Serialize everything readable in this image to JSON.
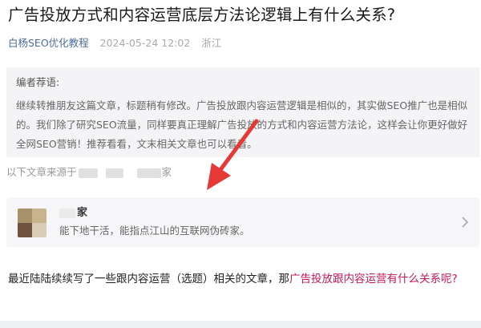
{
  "article": {
    "title": "广告投放方式和内容运营底层方法论逻辑上有什么关系?",
    "author": "白杨SEO优化教程",
    "date": "2024-05-24 12:02",
    "location": "浙江"
  },
  "editor_note": {
    "label": "编者荐语:",
    "body": "继续转推朋友这篇文章，标题稍有修改。广告投放跟内容运营逻辑是相似的，其实做SEO推广也是相似的。我们除了研究SEO流量，同样要真正理解广告投放的方式和内容运营方法论，这样会让你更好做好全网SEO营销！推荐看看，文末相关文章也可以看看。"
  },
  "source_line": {
    "prefix": "以下文章来源于",
    "suffix": "家"
  },
  "account_card": {
    "name": "家",
    "description": "能下地干活，能指点江山的互联网伪砖家。"
  },
  "content": {
    "intro": "最近陆陆续续写了一些跟内容运营（选题）相关的文章，那",
    "link_text": "广告投放跟内容运营有什么关系呢?"
  },
  "colors": {
    "author": "#4a6d9a",
    "link": "#c2185b",
    "arrow": "#e53935",
    "note_bg": "#f4f4f6"
  }
}
